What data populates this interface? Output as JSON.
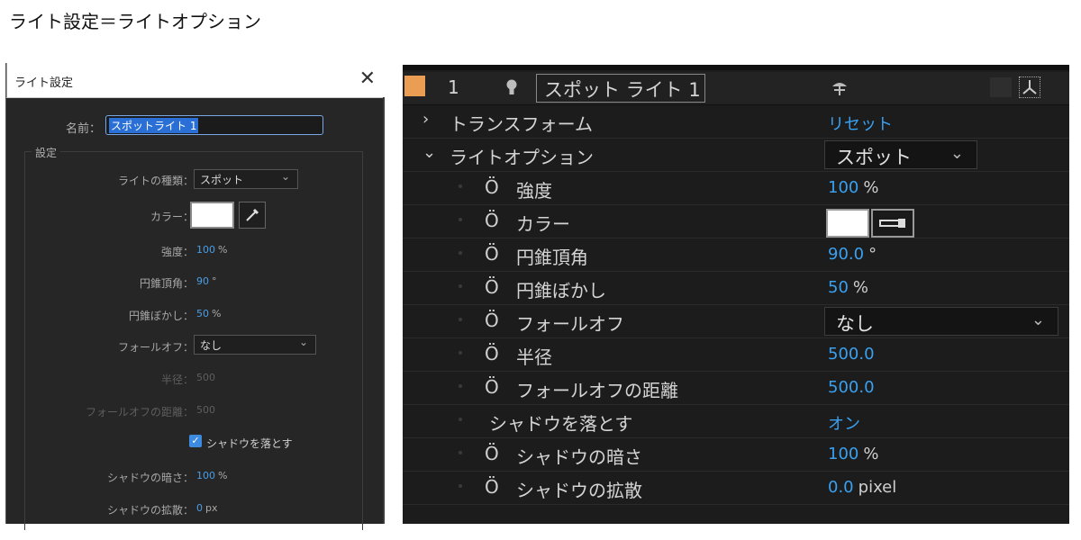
{
  "caption": "ライト設定＝ライトオプション",
  "dialog": {
    "title": "ライト設定",
    "close": "✕",
    "name_label": "名前：",
    "name_value": "スポットライト 1",
    "group_label": "設定",
    "rows": {
      "type": {
        "label": "ライトの種類：",
        "value": "スポット",
        "chev": "⌄"
      },
      "color": {
        "label": "カラー："
      },
      "intensity": {
        "label": "強度：",
        "value": "100",
        "unit": "%"
      },
      "cone_angle": {
        "label": "円錐頂角：",
        "value": "90",
        "unit": "°"
      },
      "cone_feather": {
        "label": "円錐ぼかし：",
        "value": "50",
        "unit": "%"
      },
      "falloff": {
        "label": "フォールオフ：",
        "value": "なし",
        "chev": "⌄"
      },
      "radius": {
        "label": "半径：",
        "value": "500"
      },
      "falloff_distance": {
        "label": "フォールオフの距離：",
        "value": "500"
      },
      "cast_shadows": {
        "label": "シャドウを落とす",
        "checked": true
      },
      "shadow_darkness": {
        "label": "シャドウの暗さ：",
        "value": "100",
        "unit": "%"
      },
      "shadow_diffusion": {
        "label": "シャドウの拡散：",
        "value": "0",
        "unit": "px"
      }
    }
  },
  "panel": {
    "layer": {
      "number": "1",
      "name": "スポット ライト 1",
      "color": "#eb9e53"
    },
    "transform": {
      "label": "トランスフォーム",
      "value": "リセット"
    },
    "light_options": {
      "label": "ライトオプション",
      "value": "スポット",
      "chev": "⌄"
    },
    "props": [
      {
        "label": "強度",
        "value": "100",
        "unit": "%"
      },
      {
        "label": "カラー"
      },
      {
        "label": "円錐頂角",
        "value": "90.0",
        "unit": "°"
      },
      {
        "label": "円錐ぼかし",
        "value": "50",
        "unit": "%"
      },
      {
        "label": "フォールオフ",
        "value": "なし",
        "chev": "⌄"
      },
      {
        "label": "半径",
        "value": "500.0"
      },
      {
        "label": "フォールオフの距離",
        "value": "500.0"
      },
      {
        "label": "シャドウを落とす",
        "value": "オン"
      },
      {
        "label": "シャドウの暗さ",
        "value": "100",
        "unit": "%"
      },
      {
        "label": "シャドウの拡散",
        "value": "0.0",
        "unit": "pixel"
      }
    ]
  }
}
